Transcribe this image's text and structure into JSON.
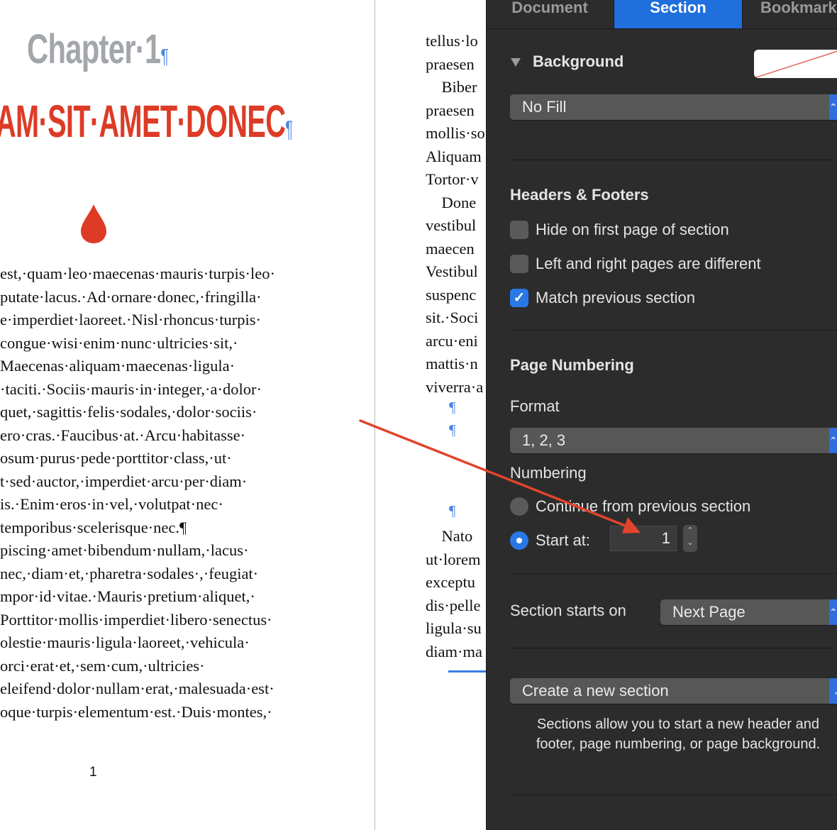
{
  "document": {
    "chapter_label": "Chapter·1",
    "chapter_title": "AM·SIT·AMET·DONEC",
    "pilcrow": "¶",
    "page_number": "1",
    "left_lines": [
      "est,·quam·leo·maecenas·mauris·turpis·leo·",
      "putate·lacus.·Ad·ornare·donec,·fringilla·",
      "e·imperdiet·laoreet.·Nisl·rhoncus·turpis·",
      "congue·wisi·enim·nunc·ultricies·sit,·",
      "Maecenas·aliquam·maecenas·ligula·",
      "·taciti.·Sociis·mauris·in·integer,·a·dolor·",
      "quet,·sagittis·felis·sodales,·dolor·sociis·",
      "ero·cras.·Faucibus·at.·Arcu·habitasse·",
      "osum·purus·pede·porttitor·class,·ut·",
      "t·sed·auctor,·imperdiet·arcu·per·diam·",
      "is.·Enim·eros·in·vel,·volutpat·nec·",
      "temporibus·scelerisque·nec.¶",
      "piscing·amet·bibendum·nullam,·lacus·",
      "nec,·diam·et,·pharetra·sodales·,·feugiat·",
      "mpor·id·vitae.·Mauris·pretium·aliquet,·",
      "Porttitor·mollis·imperdiet·libero·senectus·",
      "olestie·mauris·ligula·laoreet,·vehicula·",
      "orci·erat·et,·sem·cum,·ultricies·",
      "eleifend·dolor·nullam·erat,·malesuada·est·",
      "oque·turpis·elementum·est.·Duis·montes,·"
    ],
    "right_lines": [
      "tellus·lo",
      "praesen",
      "    Biber",
      "praesen",
      "mollis·so",
      "Aliquam",
      "Tortor·v",
      "    Done",
      "vestibul",
      "maecen",
      "Vestibul",
      "suspenc",
      "sit.·Soci",
      "arcu·eni",
      "mattis·n",
      "viverra·a"
    ],
    "right_lines_2": [
      "    Nato",
      "ut·lorem",
      "exceptu",
      "dis·pelle",
      "ligula·su",
      "diam·ma"
    ]
  },
  "inspector": {
    "tabs": [
      {
        "label": "Document",
        "active": false
      },
      {
        "label": "Section",
        "active": true
      },
      {
        "label": "Bookmark",
        "active": false
      }
    ],
    "background": {
      "label": "Background",
      "fill_value": "No Fill"
    },
    "headers_footers": {
      "label": "Headers & Footers",
      "options": [
        {
          "label": "Hide on first page of section",
          "checked": false
        },
        {
          "label": "Left and right pages are different",
          "checked": false
        },
        {
          "label": "Match previous section",
          "checked": true
        }
      ]
    },
    "page_numbering": {
      "label": "Page Numbering",
      "format_label": "Format",
      "format_value": "1, 2, 3",
      "numbering_label": "Numbering",
      "continue_label": "Continue from previous section",
      "start_at_label": "Start at:",
      "start_at_value": "1",
      "selected": "start_at"
    },
    "section_starts": {
      "label": "Section starts on",
      "value": "Next Page"
    },
    "create_section": {
      "button_label": "Create a new section",
      "helper_text": "Sections allow you to start a new header and footer, page numbering, or page background."
    }
  },
  "colors": {
    "accent": "#1f6fdc",
    "title_red": "#dd3b26",
    "chapter_gray": "#a3a6aa",
    "annotation_arrow": "#e0442c",
    "panel_bg": "#2c2c2c"
  }
}
